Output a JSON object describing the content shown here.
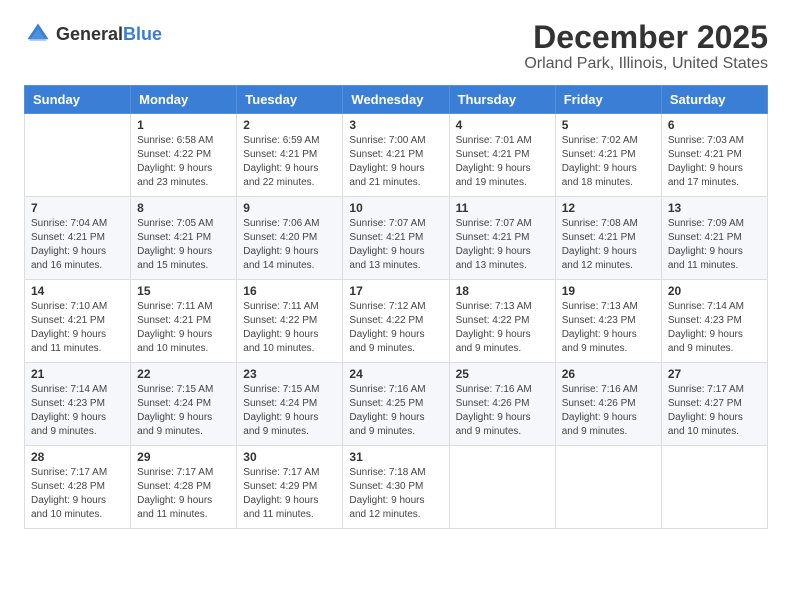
{
  "header": {
    "logo_general": "General",
    "logo_blue": "Blue",
    "month": "December 2025",
    "location": "Orland Park, Illinois, United States"
  },
  "days_of_week": [
    "Sunday",
    "Monday",
    "Tuesday",
    "Wednesday",
    "Thursday",
    "Friday",
    "Saturday"
  ],
  "weeks": [
    [
      {
        "day": "",
        "sunrise": "",
        "sunset": "",
        "daylight": ""
      },
      {
        "day": "1",
        "sunrise": "Sunrise: 6:58 AM",
        "sunset": "Sunset: 4:22 PM",
        "daylight": "Daylight: 9 hours and 23 minutes."
      },
      {
        "day": "2",
        "sunrise": "Sunrise: 6:59 AM",
        "sunset": "Sunset: 4:21 PM",
        "daylight": "Daylight: 9 hours and 22 minutes."
      },
      {
        "day": "3",
        "sunrise": "Sunrise: 7:00 AM",
        "sunset": "Sunset: 4:21 PM",
        "daylight": "Daylight: 9 hours and 21 minutes."
      },
      {
        "day": "4",
        "sunrise": "Sunrise: 7:01 AM",
        "sunset": "Sunset: 4:21 PM",
        "daylight": "Daylight: 9 hours and 19 minutes."
      },
      {
        "day": "5",
        "sunrise": "Sunrise: 7:02 AM",
        "sunset": "Sunset: 4:21 PM",
        "daylight": "Daylight: 9 hours and 18 minutes."
      },
      {
        "day": "6",
        "sunrise": "Sunrise: 7:03 AM",
        "sunset": "Sunset: 4:21 PM",
        "daylight": "Daylight: 9 hours and 17 minutes."
      }
    ],
    [
      {
        "day": "7",
        "sunrise": "Sunrise: 7:04 AM",
        "sunset": "Sunset: 4:21 PM",
        "daylight": "Daylight: 9 hours and 16 minutes."
      },
      {
        "day": "8",
        "sunrise": "Sunrise: 7:05 AM",
        "sunset": "Sunset: 4:21 PM",
        "daylight": "Daylight: 9 hours and 15 minutes."
      },
      {
        "day": "9",
        "sunrise": "Sunrise: 7:06 AM",
        "sunset": "Sunset: 4:20 PM",
        "daylight": "Daylight: 9 hours and 14 minutes."
      },
      {
        "day": "10",
        "sunrise": "Sunrise: 7:07 AM",
        "sunset": "Sunset: 4:21 PM",
        "daylight": "Daylight: 9 hours and 13 minutes."
      },
      {
        "day": "11",
        "sunrise": "Sunrise: 7:07 AM",
        "sunset": "Sunset: 4:21 PM",
        "daylight": "Daylight: 9 hours and 13 minutes."
      },
      {
        "day": "12",
        "sunrise": "Sunrise: 7:08 AM",
        "sunset": "Sunset: 4:21 PM",
        "daylight": "Daylight: 9 hours and 12 minutes."
      },
      {
        "day": "13",
        "sunrise": "Sunrise: 7:09 AM",
        "sunset": "Sunset: 4:21 PM",
        "daylight": "Daylight: 9 hours and 11 minutes."
      }
    ],
    [
      {
        "day": "14",
        "sunrise": "Sunrise: 7:10 AM",
        "sunset": "Sunset: 4:21 PM",
        "daylight": "Daylight: 9 hours and 11 minutes."
      },
      {
        "day": "15",
        "sunrise": "Sunrise: 7:11 AM",
        "sunset": "Sunset: 4:21 PM",
        "daylight": "Daylight: 9 hours and 10 minutes."
      },
      {
        "day": "16",
        "sunrise": "Sunrise: 7:11 AM",
        "sunset": "Sunset: 4:22 PM",
        "daylight": "Daylight: 9 hours and 10 minutes."
      },
      {
        "day": "17",
        "sunrise": "Sunrise: 7:12 AM",
        "sunset": "Sunset: 4:22 PM",
        "daylight": "Daylight: 9 hours and 9 minutes."
      },
      {
        "day": "18",
        "sunrise": "Sunrise: 7:13 AM",
        "sunset": "Sunset: 4:22 PM",
        "daylight": "Daylight: 9 hours and 9 minutes."
      },
      {
        "day": "19",
        "sunrise": "Sunrise: 7:13 AM",
        "sunset": "Sunset: 4:23 PM",
        "daylight": "Daylight: 9 hours and 9 minutes."
      },
      {
        "day": "20",
        "sunrise": "Sunrise: 7:14 AM",
        "sunset": "Sunset: 4:23 PM",
        "daylight": "Daylight: 9 hours and 9 minutes."
      }
    ],
    [
      {
        "day": "21",
        "sunrise": "Sunrise: 7:14 AM",
        "sunset": "Sunset: 4:23 PM",
        "daylight": "Daylight: 9 hours and 9 minutes."
      },
      {
        "day": "22",
        "sunrise": "Sunrise: 7:15 AM",
        "sunset": "Sunset: 4:24 PM",
        "daylight": "Daylight: 9 hours and 9 minutes."
      },
      {
        "day": "23",
        "sunrise": "Sunrise: 7:15 AM",
        "sunset": "Sunset: 4:24 PM",
        "daylight": "Daylight: 9 hours and 9 minutes."
      },
      {
        "day": "24",
        "sunrise": "Sunrise: 7:16 AM",
        "sunset": "Sunset: 4:25 PM",
        "daylight": "Daylight: 9 hours and 9 minutes."
      },
      {
        "day": "25",
        "sunrise": "Sunrise: 7:16 AM",
        "sunset": "Sunset: 4:26 PM",
        "daylight": "Daylight: 9 hours and 9 minutes."
      },
      {
        "day": "26",
        "sunrise": "Sunrise: 7:16 AM",
        "sunset": "Sunset: 4:26 PM",
        "daylight": "Daylight: 9 hours and 9 minutes."
      },
      {
        "day": "27",
        "sunrise": "Sunrise: 7:17 AM",
        "sunset": "Sunset: 4:27 PM",
        "daylight": "Daylight: 9 hours and 10 minutes."
      }
    ],
    [
      {
        "day": "28",
        "sunrise": "Sunrise: 7:17 AM",
        "sunset": "Sunset: 4:28 PM",
        "daylight": "Daylight: 9 hours and 10 minutes."
      },
      {
        "day": "29",
        "sunrise": "Sunrise: 7:17 AM",
        "sunset": "Sunset: 4:28 PM",
        "daylight": "Daylight: 9 hours and 11 minutes."
      },
      {
        "day": "30",
        "sunrise": "Sunrise: 7:17 AM",
        "sunset": "Sunset: 4:29 PM",
        "daylight": "Daylight: 9 hours and 11 minutes."
      },
      {
        "day": "31",
        "sunrise": "Sunrise: 7:18 AM",
        "sunset": "Sunset: 4:30 PM",
        "daylight": "Daylight: 9 hours and 12 minutes."
      },
      {
        "day": "",
        "sunrise": "",
        "sunset": "",
        "daylight": ""
      },
      {
        "day": "",
        "sunrise": "",
        "sunset": "",
        "daylight": ""
      },
      {
        "day": "",
        "sunrise": "",
        "sunset": "",
        "daylight": ""
      }
    ]
  ]
}
